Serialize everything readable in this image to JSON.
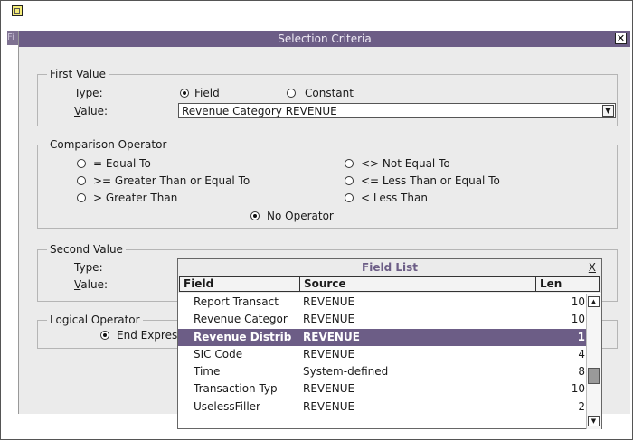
{
  "dialog": {
    "title": "Selection Criteria",
    "close_glyph": "✕"
  },
  "behind_window_stub": "Fi",
  "first_value": {
    "legend": "First Value",
    "type_label": "Type:",
    "value_label_prefix": "V",
    "value_label_rest": "alue:",
    "type_options": [
      "Field",
      "Constant"
    ],
    "type_selected": "Field",
    "value_text": "Revenue Category REVENUE"
  },
  "comparison": {
    "legend": "Comparison Operator",
    "options": [
      "= Equal To",
      "<> Not Equal To",
      ">= Greater Than or Equal To",
      "<= Less Than or Equal To",
      "> Greater Than",
      "< Less Than",
      "No Operator"
    ],
    "selected": "No Operator"
  },
  "second_value": {
    "legend": "Second Value",
    "type_label": "Type:",
    "value_label_prefix": "V",
    "value_label_rest": "alue:"
  },
  "logical": {
    "legend": "Logical Operator",
    "option_visible": "End Expres"
  },
  "field_list": {
    "title": "Field List",
    "close_glyph": "X",
    "columns": [
      "Field",
      "Source",
      "Len"
    ],
    "rows": [
      {
        "field": "Report Transact",
        "source": "REVENUE",
        "len": "10"
      },
      {
        "field": "Revenue Categor",
        "source": "REVENUE",
        "len": "10"
      },
      {
        "field": "Revenue Distrib",
        "source": "REVENUE",
        "len": "1"
      },
      {
        "field": "SIC Code",
        "source": "REVENUE",
        "len": "4"
      },
      {
        "field": "Time",
        "source": "System-defined",
        "len": "8"
      },
      {
        "field": "Transaction Typ",
        "source": "REVENUE",
        "len": "10"
      },
      {
        "field": "UselessFiller",
        "source": "REVENUE",
        "len": "2"
      }
    ],
    "selected_field": "Revenue Distrib"
  }
}
